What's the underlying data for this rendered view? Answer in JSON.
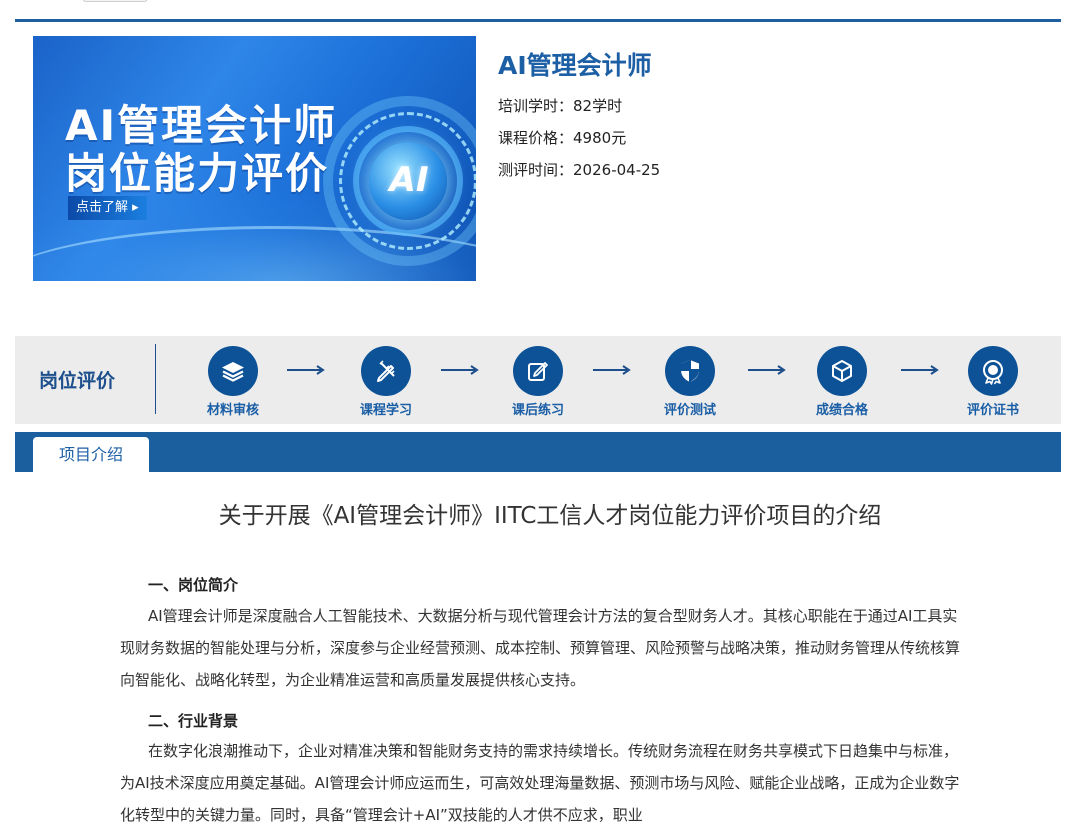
{
  "banner": {
    "title_line1": "AI管理会计师",
    "title_line2": "岗位能力评价",
    "badge": "AI",
    "cta": "点击了解 ▸"
  },
  "course": {
    "title": "AI管理会计师",
    "hours_label": "培训学时：",
    "hours_value": "82学时",
    "price_label": "课程价格：",
    "price_value": "4980元",
    "date_label": "测评时间：",
    "date_value": "2026-04-25"
  },
  "process": {
    "label": "岗位评价",
    "steps": [
      {
        "label": "材料审核",
        "icon": "layers-icon"
      },
      {
        "label": "课程学习",
        "icon": "pencil-ruler-icon"
      },
      {
        "label": "课后练习",
        "icon": "edit-note-icon"
      },
      {
        "label": "评价测试",
        "icon": "shield-icon"
      },
      {
        "label": "成绩合格",
        "icon": "cube-icon"
      },
      {
        "label": "评价证书",
        "icon": "medal-icon"
      }
    ],
    "color": "#0d5296"
  },
  "tabs": [
    {
      "label": "项目介绍",
      "active": true
    }
  ],
  "article": {
    "title": "关于开展《AI管理会计师》IITC工信人才岗位能力评价项目的介绍",
    "section1_heading": "一、岗位简介",
    "section1_text": "AI管理会计师是深度融合人工智能技术、大数据分析与现代管理会计方法的复合型财务人才。其核心职能在于通过AI工具实现财务数据的智能处理与分析，深度参与企业经营预测、成本控制、预算管理、风险预警与战略决策，推动财务管理从传统核算向智能化、战略化转型，为企业精准运营和高质量发展提供核心支持。",
    "section2_heading": "二、行业背景",
    "section2_text": "在数字化浪潮推动下，企业对精准决策和智能财务支持的需求持续增长。传统财务流程在财务共享模式下日趋集中与标准，为AI技术深度应用奠定基础。AI管理会计师应运而生，可高效处理海量数据、预测市场与风险、赋能企业战略，正成为企业数字化转型中的关键力量。同时，具备“管理会计+AI”双技能的人才供不应求，职业"
  }
}
